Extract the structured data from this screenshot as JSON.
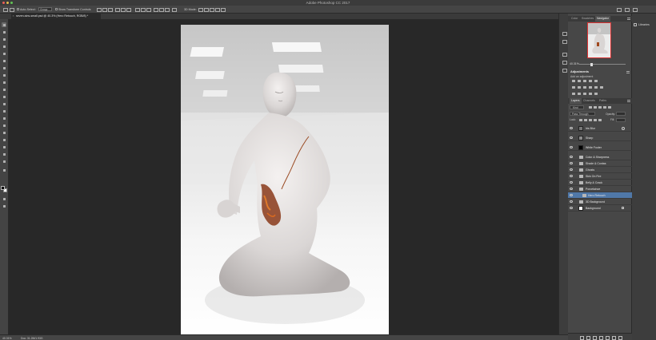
{
  "app": {
    "title": "Adobe Photoshop CC 2017"
  },
  "options_bar": {
    "auto_select_label": "Auto-Select:",
    "auto_select_target": "Group",
    "show_transform_label": "Show Transform Controls",
    "mode_3d_label": "3D Mode:"
  },
  "document": {
    "tab_title": "seven-sins-small.psd @ 40.3% (Hero Retouch, RGB/8) *",
    "close_glyph": "×"
  },
  "status_bar": {
    "zoom": "40.31%",
    "doc_size": "Doc: 31.2M/1.93G"
  },
  "panel_top": {
    "tabs": [
      "Color",
      "Swatches",
      "Navigator"
    ],
    "active_tab": "Navigator",
    "zoom": "40.31%"
  },
  "adjustments": {
    "title": "Adjustments",
    "hint": "Add an adjustment"
  },
  "layers_panel": {
    "tabs": [
      "Layers",
      "Channels",
      "Paths"
    ],
    "active_tab": "Layers",
    "kind_filter": "Kind",
    "blend_mode": "Pass Through",
    "opacity_label": "Opacity:",
    "fill_label": "Fill:",
    "lock_label": "Lock:",
    "layers": [
      {
        "name": "Iris Blur",
        "type": "smart-filter",
        "selected": false
      },
      {
        "name": "Sharp",
        "type": "layer",
        "selected": false
      },
      {
        "name": "White Footer",
        "type": "layer",
        "selected": false
      },
      {
        "name": "Color & Sharpness",
        "type": "group",
        "selected": false
      },
      {
        "name": "Shade & Contas",
        "type": "group",
        "selected": false
      },
      {
        "name": "Ghosts",
        "type": "group",
        "selected": false
      },
      {
        "name": "Skin On Fire",
        "type": "group",
        "selected": false
      },
      {
        "name": "Belly & Crack",
        "type": "group",
        "selected": false
      },
      {
        "name": "Porcelaince",
        "type": "group",
        "selected": false
      },
      {
        "name": "Hero Retouch",
        "type": "group",
        "selected": true
      },
      {
        "name": "3D Background",
        "type": "group",
        "selected": false
      },
      {
        "name": "Background",
        "type": "layer",
        "selected": false
      }
    ]
  },
  "libraries": {
    "label": "Libraries"
  },
  "colors": {
    "selection": "#5078a8",
    "canvas_bg": "#282828",
    "panel_bg": "#474747"
  }
}
